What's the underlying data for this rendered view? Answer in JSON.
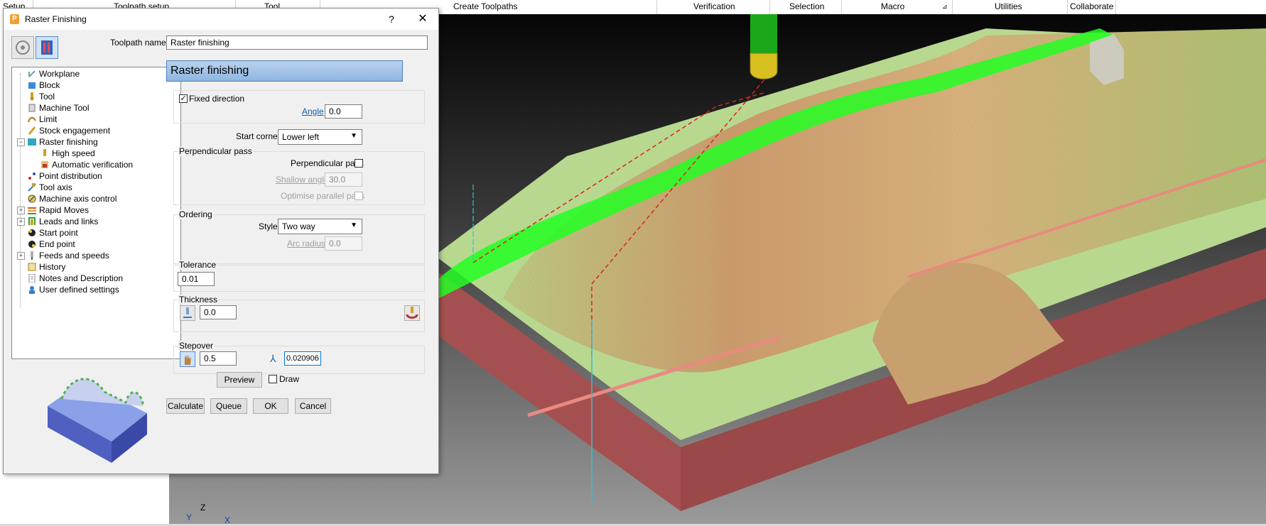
{
  "ribbon": {
    "tabs": [
      "Setup",
      "Toolpath setup",
      "Tool",
      "Create Toolpaths",
      "Verification",
      "Selection",
      "Macro",
      "Utilities",
      "Collaborate"
    ]
  },
  "viewport": {
    "axes": {
      "y": "Y",
      "z": "Z",
      "x": "X"
    }
  },
  "dialog": {
    "title": "Raster Finishing",
    "help": "?",
    "close": "✕",
    "app_icon": "P",
    "toolpath_name_label": "Toolpath name",
    "toolpath_name_value": "Raster finishing",
    "section_header": "Raster finishing",
    "tree": [
      "Workplane",
      "Block",
      "Tool",
      "Machine Tool",
      "Limit",
      "Stock engagement",
      "Raster finishing",
      "High speed",
      "Automatic verification",
      "Point distribution",
      "Tool axis",
      "Machine axis control",
      "Rapid Moves",
      "Leads and links",
      "Start point",
      "End point",
      "Feeds and speeds",
      "History",
      "Notes and Description",
      "User defined settings"
    ],
    "fixed_direction": {
      "label": "Fixed direction",
      "checked": true
    },
    "angle": {
      "label": "Angle",
      "value": "0.0"
    },
    "start_corner": {
      "label": "Start corner",
      "value": "Lower left"
    },
    "perpendicular": {
      "group_label": "Perpendicular pass",
      "checkbox_label": "Perpendicular pass",
      "shallow_label": "Shallow angle",
      "shallow_value": "30.0",
      "optimise_label": "Optimise parallel pass"
    },
    "ordering": {
      "group_label": "Ordering",
      "style_label": "Style",
      "style_value": "Two way",
      "arc_label": "Arc radius",
      "arc_value": "0.0"
    },
    "tolerance": {
      "label": "Tolerance",
      "value": "0.01"
    },
    "thickness": {
      "label": "Thickness",
      "value": "0.0"
    },
    "stepover": {
      "label": "Stepover",
      "value": "0.5",
      "cusp_value": "0.020906"
    },
    "preview_button": "Preview",
    "draw_label": "Draw",
    "buttons": {
      "calculate": "Calculate",
      "queue": "Queue",
      "ok": "OK",
      "cancel": "Cancel"
    }
  },
  "colors": {
    "header_band": "#9fc2e8",
    "toolpath_green": "#22ff22",
    "model_pink": "#a55050",
    "model_tan": "#c8a070",
    "floor_green": "#b8d890"
  }
}
